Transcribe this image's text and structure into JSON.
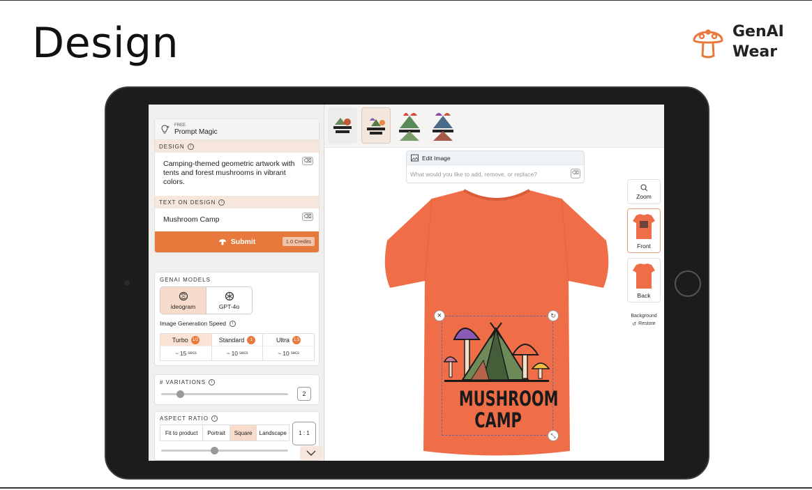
{
  "slide": {
    "title": "Design",
    "brand": {
      "line1": "GenAI",
      "line2": "Wear"
    }
  },
  "prompt_magic": {
    "free_label": "FREE",
    "label": "Prompt Magic"
  },
  "design": {
    "heading": "DESIGN",
    "text": "Camping-themed geometric artwork with tents and forest mushrooms in vibrant colors."
  },
  "text_on_design": {
    "heading": "TEXT ON DESIGN",
    "value": "Mushroom Camp"
  },
  "submit": {
    "label": "Submit",
    "credits": "1.0 Credits"
  },
  "models": {
    "heading": "GENAI MODELS",
    "items": [
      {
        "label": "ideogram",
        "active": true
      },
      {
        "label": "GPT-4o",
        "active": false
      }
    ]
  },
  "speed": {
    "heading": "Image Generation Speed",
    "options": [
      {
        "label": "Turbo",
        "badge": "1/2",
        "time": "15",
        "unit": "secs",
        "active": true
      },
      {
        "label": "Standard",
        "badge": "1",
        "time": "10",
        "unit": "secs",
        "active": false
      },
      {
        "label": "Ultra",
        "badge": "1.5",
        "time": "10",
        "unit": "secs",
        "active": false
      }
    ]
  },
  "variations": {
    "heading": "# VARIATIONS",
    "value": "2",
    "level": 0.15
  },
  "aspect": {
    "heading": "ASPECT RATIO",
    "options": [
      "Fit to product",
      "Portrait",
      "Square",
      "Landscape"
    ],
    "selected": "Square",
    "ratio": "1 : 1",
    "level": 0.42
  },
  "edit_image": {
    "label": "Edit Image",
    "placeholder": "What would you like to add, remove, or replace?"
  },
  "artwork": {
    "line1": "MUSHROOM",
    "line2": "CAMP"
  },
  "tools": {
    "zoom": "Zoom",
    "front": "Front",
    "back": "Back",
    "background": "Background",
    "restore": "Restore"
  },
  "colors": {
    "accent": "#e8793c",
    "shirt": "#ef6e48",
    "accent_light": "#f8dccb"
  }
}
